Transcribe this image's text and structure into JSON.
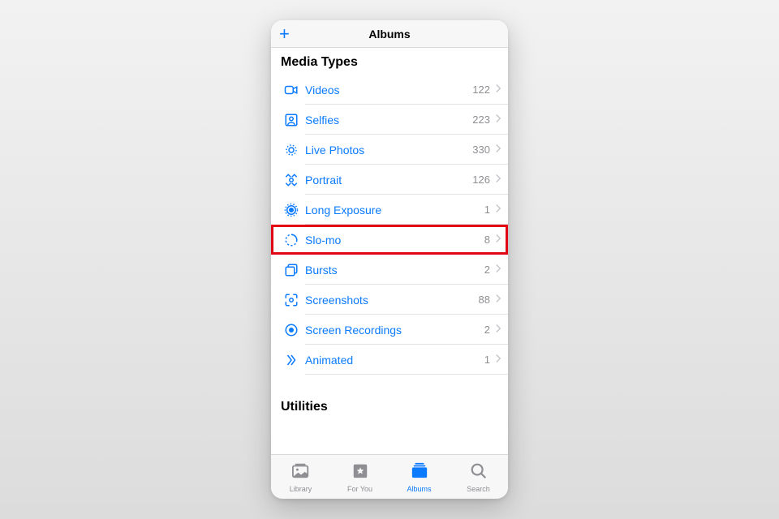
{
  "navbar": {
    "title": "Albums",
    "add_glyph": "+"
  },
  "section1": {
    "header": "Media Types"
  },
  "section2": {
    "header": "Utilities"
  },
  "rows": [
    {
      "icon": "video-icon",
      "label": "Videos",
      "count": "122",
      "highlight": false
    },
    {
      "icon": "selfie-icon",
      "label": "Selfies",
      "count": "223",
      "highlight": false
    },
    {
      "icon": "livephoto-icon",
      "label": "Live Photos",
      "count": "330",
      "highlight": false
    },
    {
      "icon": "portrait-icon",
      "label": "Portrait",
      "count": "126",
      "highlight": false
    },
    {
      "icon": "longexposure-icon",
      "label": "Long Exposure",
      "count": "1",
      "highlight": false
    },
    {
      "icon": "slomo-icon",
      "label": "Slo-mo",
      "count": "8",
      "highlight": true
    },
    {
      "icon": "bursts-icon",
      "label": "Bursts",
      "count": "2",
      "highlight": false
    },
    {
      "icon": "screenshots-icon",
      "label": "Screenshots",
      "count": "88",
      "highlight": false
    },
    {
      "icon": "screenrecordings-icon",
      "label": "Screen Recordings",
      "count": "2",
      "highlight": false
    },
    {
      "icon": "animated-icon",
      "label": "Animated",
      "count": "1",
      "highlight": false
    }
  ],
  "tabs": [
    {
      "name": "library",
      "label": "Library",
      "active": false
    },
    {
      "name": "foryou",
      "label": "For You",
      "active": false
    },
    {
      "name": "albums",
      "label": "Albums",
      "active": true
    },
    {
      "name": "search",
      "label": "Search",
      "active": false
    }
  ]
}
